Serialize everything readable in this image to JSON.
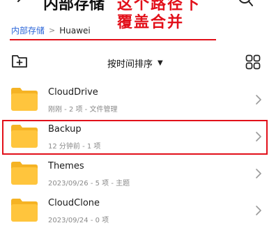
{
  "header": {
    "title_cut": "内部存储"
  },
  "annotation": {
    "line1": "这个路径下",
    "line2": "覆盖合并",
    "color": "#e2101a"
  },
  "breadcrumb": {
    "root": "内部存储",
    "separator": ">",
    "current": "Huawei"
  },
  "toolbar": {
    "sort_label": "按时间排序",
    "sort_caret": "▼"
  },
  "items": [
    {
      "name": "CloudDrive",
      "meta": "刚刚 - 2 项 - 文件管理"
    },
    {
      "name": "Backup",
      "meta": "12 分钟前 - 1 项"
    },
    {
      "name": "Themes",
      "meta": "2023/09/26 - 5 项 - 主题"
    },
    {
      "name": "CloudClone",
      "meta": "2023/09/24 - 0 项"
    }
  ],
  "colors": {
    "folder": "#ffc53d",
    "folder_tab": "#f5b324",
    "link": "#2b66d9"
  },
  "icons": [
    "back-arrow-icon",
    "search-icon",
    "new-folder-icon",
    "grid-view-icon",
    "folder-icon",
    "chevron-right-icon"
  ]
}
